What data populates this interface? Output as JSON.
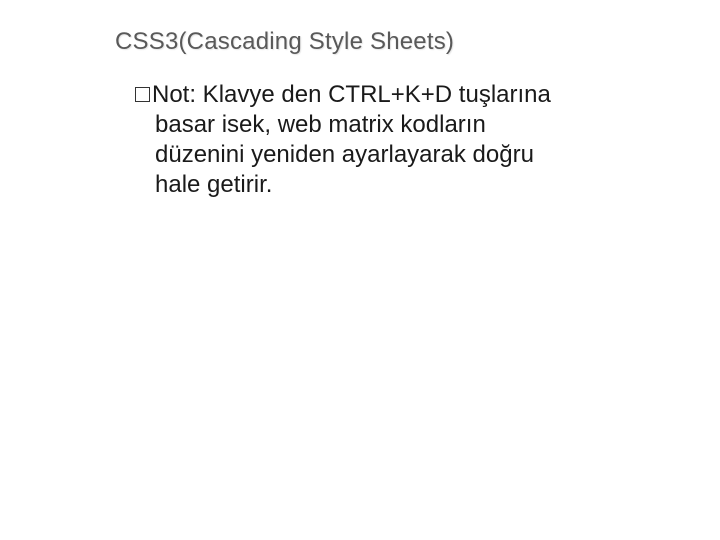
{
  "title": "CSS3(Cascading Style Sheets)",
  "body": {
    "note_label": "Not:",
    "rest_line1": " Klavye den CTRL+K+D tuşlarına",
    "line2": "basar isek, web matrix kodların",
    "line3": "düzenini yeniden ayarlayarak doğru",
    "line4": "hale getirir."
  }
}
